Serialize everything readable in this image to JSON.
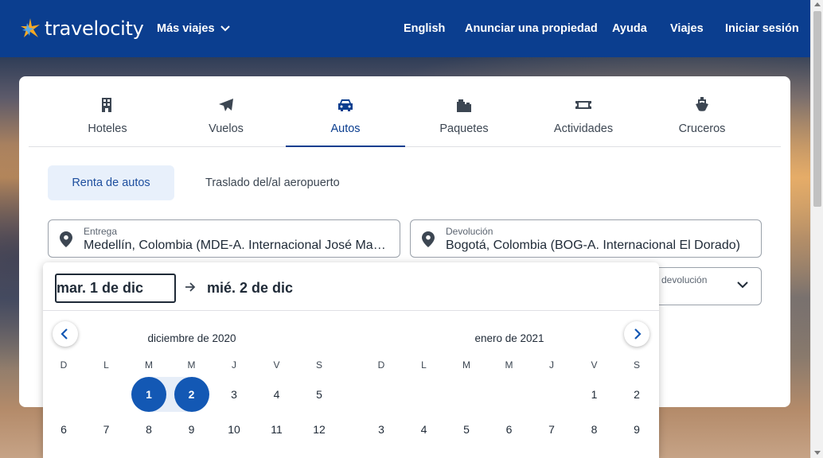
{
  "header": {
    "logo_text": "travelocity",
    "more_trips": "Más viajes",
    "nav": [
      "English",
      "Anunciar una propiedad",
      "Ayuda",
      "Viajes",
      "Iniciar sesión"
    ]
  },
  "tabs": [
    {
      "label": "Hoteles",
      "icon": "hotel-icon"
    },
    {
      "label": "Vuelos",
      "icon": "plane-icon"
    },
    {
      "label": "Autos",
      "icon": "car-icon",
      "active": true
    },
    {
      "label": "Paquetes",
      "icon": "luggage-icon"
    },
    {
      "label": "Actividades",
      "icon": "ticket-icon"
    },
    {
      "label": "Cruceros",
      "icon": "ship-icon"
    }
  ],
  "subtabs": {
    "active": "Renta de autos",
    "other": "Traslado del/al aeropuerto"
  },
  "pickup": {
    "label": "Entrega",
    "value": "Medellín, Colombia (MDE-A. Internacional José María Córdova)"
  },
  "dropoff": {
    "label": "Devolución",
    "value": "Bogotá, Colombia (BOG-A. Internacional El Dorado)"
  },
  "return_time": {
    "label": "devolución"
  },
  "picker": {
    "start": "mar. 1 de dic",
    "end": "mié. 2 de dic",
    "months": [
      {
        "title": "diciembre de 2020",
        "dow": [
          "D",
          "L",
          "M",
          "M",
          "J",
          "V",
          "S"
        ],
        "rows": [
          [
            "",
            "",
            "1",
            "2",
            "3",
            "4",
            "5"
          ],
          [
            "6",
            "7",
            "8",
            "9",
            "10",
            "11",
            "12"
          ]
        ]
      },
      {
        "title": "enero de 2021",
        "dow": [
          "D",
          "L",
          "M",
          "M",
          "J",
          "V",
          "S"
        ],
        "rows": [
          [
            "",
            "",
            "",
            "",
            "",
            "1",
            "2"
          ],
          [
            "3",
            "4",
            "5",
            "6",
            "7",
            "8",
            "9"
          ]
        ]
      }
    ],
    "selected": [
      "1",
      "2"
    ]
  },
  "colors": {
    "brand": "#0b3e8f",
    "selected": "#1358b4"
  }
}
